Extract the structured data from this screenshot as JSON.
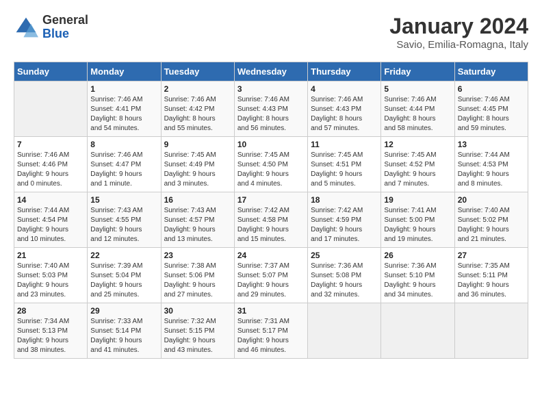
{
  "header": {
    "logo_line1": "General",
    "logo_line2": "Blue",
    "month": "January 2024",
    "location": "Savio, Emilia-Romagna, Italy"
  },
  "weekdays": [
    "Sunday",
    "Monday",
    "Tuesday",
    "Wednesday",
    "Thursday",
    "Friday",
    "Saturday"
  ],
  "weeks": [
    [
      {
        "day": "",
        "info": ""
      },
      {
        "day": "1",
        "info": "Sunrise: 7:46 AM\nSunset: 4:41 PM\nDaylight: 8 hours\nand 54 minutes."
      },
      {
        "day": "2",
        "info": "Sunrise: 7:46 AM\nSunset: 4:42 PM\nDaylight: 8 hours\nand 55 minutes."
      },
      {
        "day": "3",
        "info": "Sunrise: 7:46 AM\nSunset: 4:43 PM\nDaylight: 8 hours\nand 56 minutes."
      },
      {
        "day": "4",
        "info": "Sunrise: 7:46 AM\nSunset: 4:43 PM\nDaylight: 8 hours\nand 57 minutes."
      },
      {
        "day": "5",
        "info": "Sunrise: 7:46 AM\nSunset: 4:44 PM\nDaylight: 8 hours\nand 58 minutes."
      },
      {
        "day": "6",
        "info": "Sunrise: 7:46 AM\nSunset: 4:45 PM\nDaylight: 8 hours\nand 59 minutes."
      }
    ],
    [
      {
        "day": "7",
        "info": "Sunrise: 7:46 AM\nSunset: 4:46 PM\nDaylight: 9 hours\nand 0 minutes."
      },
      {
        "day": "8",
        "info": "Sunrise: 7:46 AM\nSunset: 4:47 PM\nDaylight: 9 hours\nand 1 minute."
      },
      {
        "day": "9",
        "info": "Sunrise: 7:45 AM\nSunset: 4:49 PM\nDaylight: 9 hours\nand 3 minutes."
      },
      {
        "day": "10",
        "info": "Sunrise: 7:45 AM\nSunset: 4:50 PM\nDaylight: 9 hours\nand 4 minutes."
      },
      {
        "day": "11",
        "info": "Sunrise: 7:45 AM\nSunset: 4:51 PM\nDaylight: 9 hours\nand 5 minutes."
      },
      {
        "day": "12",
        "info": "Sunrise: 7:45 AM\nSunset: 4:52 PM\nDaylight: 9 hours\nand 7 minutes."
      },
      {
        "day": "13",
        "info": "Sunrise: 7:44 AM\nSunset: 4:53 PM\nDaylight: 9 hours\nand 8 minutes."
      }
    ],
    [
      {
        "day": "14",
        "info": "Sunrise: 7:44 AM\nSunset: 4:54 PM\nDaylight: 9 hours\nand 10 minutes."
      },
      {
        "day": "15",
        "info": "Sunrise: 7:43 AM\nSunset: 4:55 PM\nDaylight: 9 hours\nand 12 minutes."
      },
      {
        "day": "16",
        "info": "Sunrise: 7:43 AM\nSunset: 4:57 PM\nDaylight: 9 hours\nand 13 minutes."
      },
      {
        "day": "17",
        "info": "Sunrise: 7:42 AM\nSunset: 4:58 PM\nDaylight: 9 hours\nand 15 minutes."
      },
      {
        "day": "18",
        "info": "Sunrise: 7:42 AM\nSunset: 4:59 PM\nDaylight: 9 hours\nand 17 minutes."
      },
      {
        "day": "19",
        "info": "Sunrise: 7:41 AM\nSunset: 5:00 PM\nDaylight: 9 hours\nand 19 minutes."
      },
      {
        "day": "20",
        "info": "Sunrise: 7:40 AM\nSunset: 5:02 PM\nDaylight: 9 hours\nand 21 minutes."
      }
    ],
    [
      {
        "day": "21",
        "info": "Sunrise: 7:40 AM\nSunset: 5:03 PM\nDaylight: 9 hours\nand 23 minutes."
      },
      {
        "day": "22",
        "info": "Sunrise: 7:39 AM\nSunset: 5:04 PM\nDaylight: 9 hours\nand 25 minutes."
      },
      {
        "day": "23",
        "info": "Sunrise: 7:38 AM\nSunset: 5:06 PM\nDaylight: 9 hours\nand 27 minutes."
      },
      {
        "day": "24",
        "info": "Sunrise: 7:37 AM\nSunset: 5:07 PM\nDaylight: 9 hours\nand 29 minutes."
      },
      {
        "day": "25",
        "info": "Sunrise: 7:36 AM\nSunset: 5:08 PM\nDaylight: 9 hours\nand 32 minutes."
      },
      {
        "day": "26",
        "info": "Sunrise: 7:36 AM\nSunset: 5:10 PM\nDaylight: 9 hours\nand 34 minutes."
      },
      {
        "day": "27",
        "info": "Sunrise: 7:35 AM\nSunset: 5:11 PM\nDaylight: 9 hours\nand 36 minutes."
      }
    ],
    [
      {
        "day": "28",
        "info": "Sunrise: 7:34 AM\nSunset: 5:13 PM\nDaylight: 9 hours\nand 38 minutes."
      },
      {
        "day": "29",
        "info": "Sunrise: 7:33 AM\nSunset: 5:14 PM\nDaylight: 9 hours\nand 41 minutes."
      },
      {
        "day": "30",
        "info": "Sunrise: 7:32 AM\nSunset: 5:15 PM\nDaylight: 9 hours\nand 43 minutes."
      },
      {
        "day": "31",
        "info": "Sunrise: 7:31 AM\nSunset: 5:17 PM\nDaylight: 9 hours\nand 46 minutes."
      },
      {
        "day": "",
        "info": ""
      },
      {
        "day": "",
        "info": ""
      },
      {
        "day": "",
        "info": ""
      }
    ]
  ]
}
